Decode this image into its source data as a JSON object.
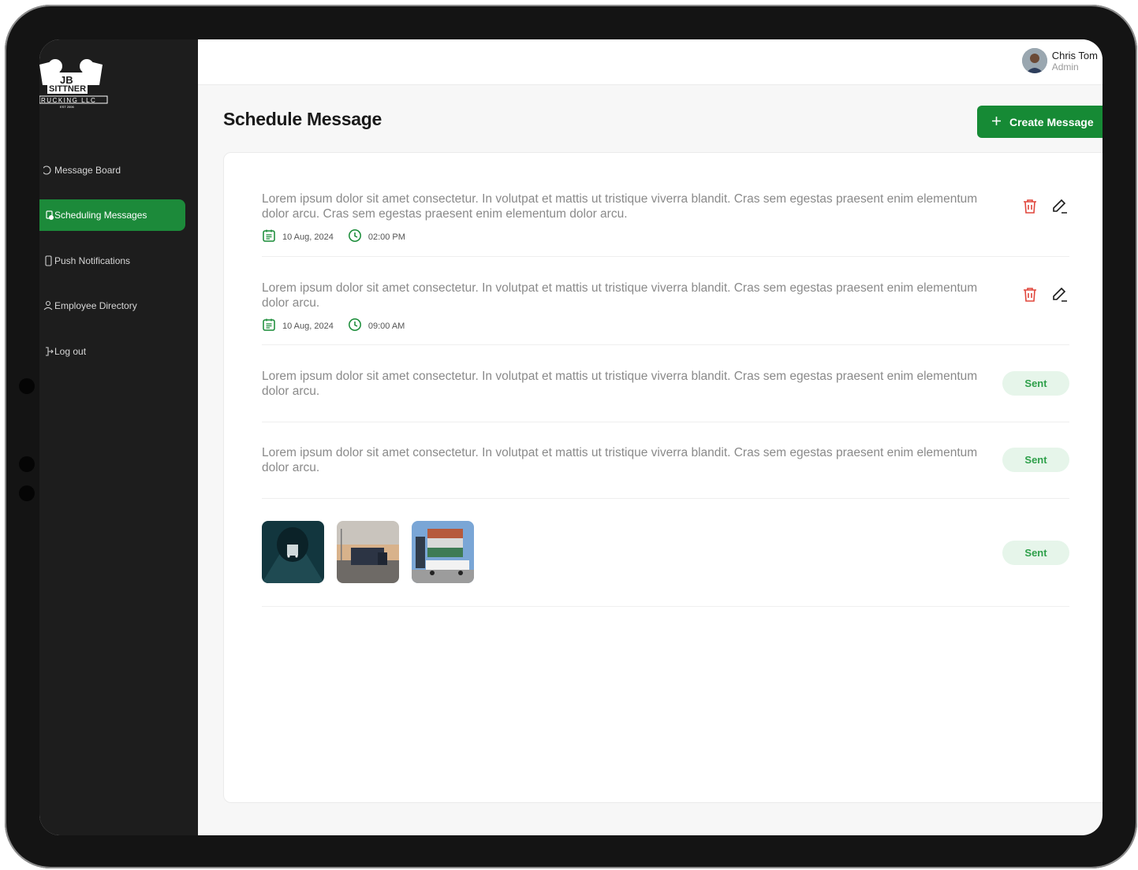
{
  "sidebar": {
    "logo_lines": [
      "JB",
      "SITTNER",
      "RUCKING LLC",
      "EST 2006"
    ],
    "items": [
      {
        "label": "Message Board",
        "active": false
      },
      {
        "label": "Scheduling Messages",
        "active": true
      },
      {
        "label": "Push Notifications",
        "active": false
      },
      {
        "label": "Employee Directory",
        "active": false
      },
      {
        "label": "Log out",
        "active": false
      }
    ]
  },
  "user": {
    "name": "Chris Tom",
    "role": "Admin"
  },
  "page": {
    "title": "Schedule Message",
    "create_label": "Create Message"
  },
  "messages": [
    {
      "text": "Lorem ipsum dolor sit amet consectetur. In volutpat et mattis ut tristique viverra blandit. Cras sem egestas praesent enim elementum dolor arcu. Cras sem egestas praesent enim elementum dolor arcu.",
      "date": "10 Aug, 2024",
      "time": "02:00 PM"
    },
    {
      "text": "Lorem ipsum dolor sit amet consectetur. In volutpat et mattis ut tristique viverra blandit. Cras sem egestas praesent enim elementum dolor arcu.",
      "date": "10 Aug, 2024",
      "time": "09:00 AM"
    },
    {
      "text": "Lorem ipsum dolor sit amet consectetur. In volutpat et mattis ut tristique viverra blandit. Cras sem egestas praesent enim elementum dolor arcu.",
      "status": "Sent"
    },
    {
      "text": "Lorem ipsum dolor sit amet consectetur. In volutpat et mattis ut tristique viverra blandit. Cras sem egestas praesent enim elementum dolor arcu.",
      "status": "Sent"
    },
    {
      "images": [
        "truck-tunnel-photo",
        "truck-highway-photo",
        "container-yard-photo"
      ],
      "status": "Sent"
    }
  ],
  "colors": {
    "accent": "#168a35",
    "delete": "#e0463c",
    "sent_bg": "#e6f5ea",
    "sent_text": "#2ea04a",
    "sidebar_bg": "#1d1d1d"
  }
}
